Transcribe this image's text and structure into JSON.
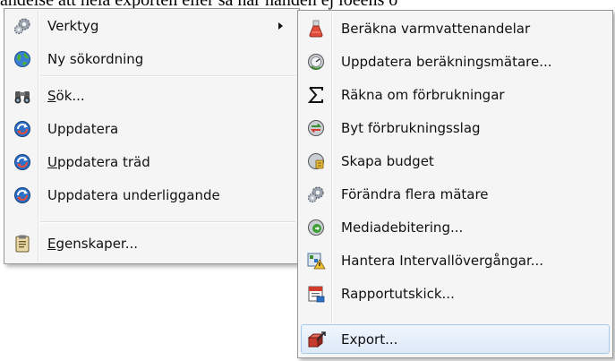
{
  "background_text": "ändelse att hela exporten eller så har handen ej löeens o",
  "main_menu": {
    "items": [
      {
        "first": "",
        "rest": "Verktyg",
        "icon": "gears-icon",
        "submenu": true
      },
      {
        "first": "",
        "rest": "Ny sökordning",
        "icon": "globe-icon"
      },
      {
        "first": "S",
        "rest": "ök...",
        "icon": "binoculars-icon"
      },
      {
        "first": "",
        "rest": "Uppdatera",
        "icon": "refresh-icon"
      },
      {
        "first": "U",
        "rest": "ppdatera träd",
        "icon": "refresh-icon"
      },
      {
        "first": "",
        "rest": "Uppdatera underliggande",
        "icon": "refresh-icon"
      },
      {
        "first": "E",
        "rest": "genskaper...",
        "icon": "clipboard-icon"
      }
    ]
  },
  "sub_menu": {
    "items": [
      {
        "label": "Beräkna varmvattenandelar",
        "icon": "flask-icon"
      },
      {
        "label": "Uppdatera beräkningsmätare...",
        "icon": "meter-refresh-icon"
      },
      {
        "label": "Räkna om förbrukningar",
        "icon": "sigma-icon"
      },
      {
        "label": "Byt förbrukningsslag",
        "icon": "swap-icon"
      },
      {
        "label": "Skapa budget",
        "icon": "budget-icon"
      },
      {
        "label": "Förändra flera mätare",
        "icon": "gears-icon"
      },
      {
        "label": "Mediadebitering...",
        "icon": "media-billing-icon"
      },
      {
        "label": "Hantera Intervallövergångar...",
        "icon": "interval-warning-icon"
      },
      {
        "label": "Rapportutskick...",
        "icon": "calendar-report-icon"
      },
      {
        "label": "Export...",
        "icon": "export-icon"
      }
    ],
    "highlighted": "Export..."
  }
}
